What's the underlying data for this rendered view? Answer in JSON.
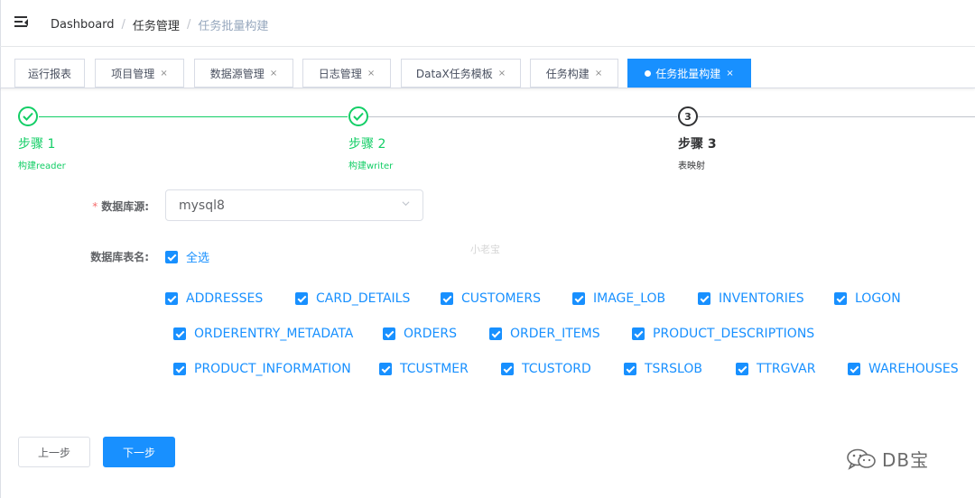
{
  "breadcrumb": {
    "items": [
      "Dashboard",
      "任务管理",
      "任务批量构建"
    ],
    "separator": "/"
  },
  "tags": [
    {
      "label": "运行报表",
      "closable": false
    },
    {
      "label": "项目管理",
      "closable": true
    },
    {
      "label": "数据源管理",
      "closable": true
    },
    {
      "label": "日志管理",
      "closable": true
    },
    {
      "label": "DataX任务模板",
      "closable": true
    },
    {
      "label": "任务构建",
      "closable": true
    },
    {
      "label": "任务批量构建",
      "closable": true,
      "active": true
    }
  ],
  "tag_close_glyph": "×",
  "steps": [
    {
      "title": "步骤 1",
      "description": "构建reader",
      "status": "finished",
      "icon": "check-circle-icon"
    },
    {
      "title": "步骤 2",
      "description": "构建writer",
      "status": "finished",
      "icon": "check-circle-icon"
    },
    {
      "title": "步骤 3",
      "description": "表映射",
      "status": "current",
      "number": "3"
    }
  ],
  "form": {
    "datasource_label": "数据库源:",
    "datasource_required_mark": "*",
    "datasource_value": "mysql8",
    "table_label": "数据库表名:",
    "select_all_label": "全选",
    "select_all_checked": true,
    "tables": [
      [
        "ADDRESSES",
        "CARD_DETAILS",
        "CUSTOMERS",
        "IMAGE_LOB",
        "INVENTORIES",
        "LOGON"
      ],
      [
        "ORDERENTRY_METADATA",
        "ORDERS",
        "ORDER_ITEMS",
        "PRODUCT_DESCRIPTIONS"
      ],
      [
        "PRODUCT_INFORMATION",
        "TCUSTMER",
        "TCUSTORD",
        "TSRSLOB",
        "TTRGVAR",
        "WAREHOUSES"
      ]
    ],
    "all_checked": true
  },
  "buttons": {
    "prev": "上一步",
    "next": "下一步"
  },
  "watermark": "小老宝",
  "brand": {
    "text": "DB宝",
    "icon": "wechat-icon"
  },
  "colors": {
    "primary": "#1890ff",
    "success": "#13ce66",
    "danger": "#f56c6c"
  }
}
